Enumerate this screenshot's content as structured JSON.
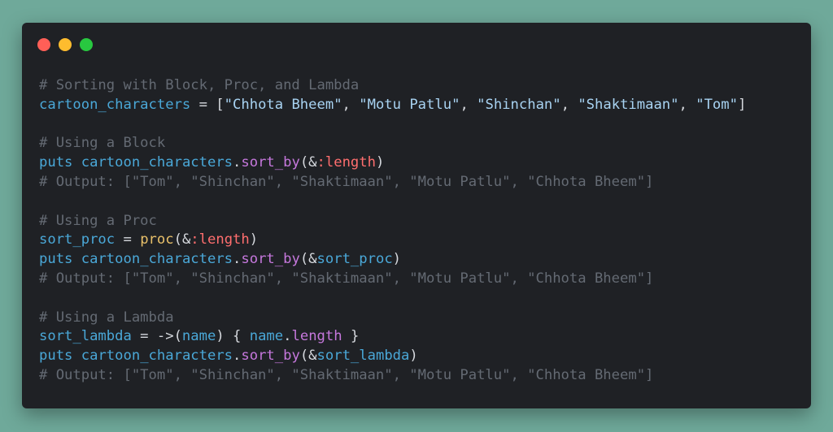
{
  "window": {
    "traffic_lights": [
      {
        "name": "close-light",
        "color": "#ff5f57"
      },
      {
        "name": "minimize-light",
        "color": "#febc2e"
      },
      {
        "name": "maximize-light",
        "color": "#28c840"
      }
    ]
  },
  "colors": {
    "background": "#6fa99a",
    "window": "#1f2125",
    "comment": "#646a73",
    "identifier": "#4aa8d8",
    "string": "#a8d3f2",
    "symbol": "#ff6e6e",
    "method": "#c678dd",
    "function": "#e8c06a"
  },
  "code": {
    "lines": [
      [
        {
          "t": "comment",
          "v": "# Sorting with Block, Proc, and Lambda"
        }
      ],
      [
        {
          "t": "ident",
          "v": "cartoon_characters"
        },
        {
          "t": "plain",
          "v": " = ["
        },
        {
          "t": "string",
          "v": "\"Chhota Bheem\""
        },
        {
          "t": "plain",
          "v": ", "
        },
        {
          "t": "string",
          "v": "\"Motu Patlu\""
        },
        {
          "t": "plain",
          "v": ", "
        },
        {
          "t": "string",
          "v": "\"Shinchan\""
        },
        {
          "t": "plain",
          "v": ", "
        },
        {
          "t": "string",
          "v": "\"Shaktimaan\""
        },
        {
          "t": "plain",
          "v": ", "
        },
        {
          "t": "string",
          "v": "\"Tom\""
        },
        {
          "t": "plain",
          "v": "]"
        }
      ],
      [],
      [
        {
          "t": "comment",
          "v": "# Using a Block"
        }
      ],
      [
        {
          "t": "ident",
          "v": "puts"
        },
        {
          "t": "plain",
          "v": " "
        },
        {
          "t": "ident",
          "v": "cartoon_characters"
        },
        {
          "t": "plain",
          "v": "."
        },
        {
          "t": "method",
          "v": "sort_by"
        },
        {
          "t": "plain",
          "v": "(&"
        },
        {
          "t": "symbol",
          "v": ":length"
        },
        {
          "t": "plain",
          "v": ")"
        }
      ],
      [
        {
          "t": "comment",
          "v": "# Output: [\"Tom\", \"Shinchan\", \"Shaktimaan\", \"Motu Patlu\", \"Chhota Bheem\"]"
        }
      ],
      [],
      [
        {
          "t": "comment",
          "v": "# Using a Proc"
        }
      ],
      [
        {
          "t": "ident",
          "v": "sort_proc"
        },
        {
          "t": "plain",
          "v": " = "
        },
        {
          "t": "func",
          "v": "proc"
        },
        {
          "t": "plain",
          "v": "(&"
        },
        {
          "t": "symbol",
          "v": ":length"
        },
        {
          "t": "plain",
          "v": ")"
        }
      ],
      [
        {
          "t": "ident",
          "v": "puts"
        },
        {
          "t": "plain",
          "v": " "
        },
        {
          "t": "ident",
          "v": "cartoon_characters"
        },
        {
          "t": "plain",
          "v": "."
        },
        {
          "t": "method",
          "v": "sort_by"
        },
        {
          "t": "plain",
          "v": "(&"
        },
        {
          "t": "ident",
          "v": "sort_proc"
        },
        {
          "t": "plain",
          "v": ")"
        }
      ],
      [
        {
          "t": "comment",
          "v": "# Output: [\"Tom\", \"Shinchan\", \"Shaktimaan\", \"Motu Patlu\", \"Chhota Bheem\"]"
        }
      ],
      [],
      [
        {
          "t": "comment",
          "v": "# Using a Lambda"
        }
      ],
      [
        {
          "t": "ident",
          "v": "sort_lambda"
        },
        {
          "t": "plain",
          "v": " = ->("
        },
        {
          "t": "ident",
          "v": "name"
        },
        {
          "t": "plain",
          "v": ") { "
        },
        {
          "t": "ident",
          "v": "name"
        },
        {
          "t": "plain",
          "v": "."
        },
        {
          "t": "method",
          "v": "length"
        },
        {
          "t": "plain",
          "v": " }"
        }
      ],
      [
        {
          "t": "ident",
          "v": "puts"
        },
        {
          "t": "plain",
          "v": " "
        },
        {
          "t": "ident",
          "v": "cartoon_characters"
        },
        {
          "t": "plain",
          "v": "."
        },
        {
          "t": "method",
          "v": "sort_by"
        },
        {
          "t": "plain",
          "v": "(&"
        },
        {
          "t": "ident",
          "v": "sort_lambda"
        },
        {
          "t": "plain",
          "v": ")"
        }
      ],
      [
        {
          "t": "comment",
          "v": "# Output: [\"Tom\", \"Shinchan\", \"Shaktimaan\", \"Motu Patlu\", \"Chhota Bheem\"]"
        }
      ]
    ]
  }
}
